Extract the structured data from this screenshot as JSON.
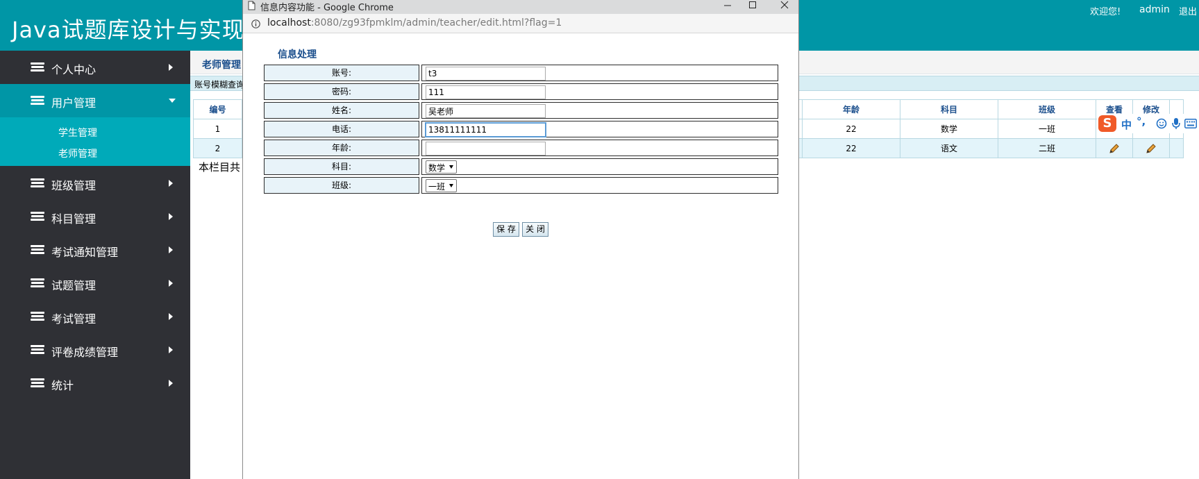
{
  "header": {
    "app_title": "Java试题库设计与实现",
    "welcome": "欢迎您!",
    "username": "admin",
    "logout": "退出"
  },
  "sidebar": {
    "items": [
      {
        "label": "个人中心"
      },
      {
        "label": "用户管理"
      },
      {
        "label": "班级管理"
      },
      {
        "label": "科目管理"
      },
      {
        "label": "考试通知管理"
      },
      {
        "label": "试题管理"
      },
      {
        "label": "考试管理"
      },
      {
        "label": "评卷成绩管理"
      },
      {
        "label": "统计"
      }
    ],
    "submenu": [
      "学生管理",
      "老师管理"
    ]
  },
  "main": {
    "title": "老师管理",
    "search_label": "账号模糊查询",
    "table": {
      "headers": [
        "编号",
        "年龄",
        "科目",
        "班级",
        "查看",
        "修改"
      ],
      "rows": [
        {
          "id": "1",
          "age": "22",
          "subject": "数学",
          "class": "一班"
        },
        {
          "id": "2",
          "age": "22",
          "subject": "语文",
          "class": "二班"
        }
      ]
    },
    "footer_note": "本栏目共"
  },
  "popup": {
    "window_title": "信息内容功能 - Google Chrome",
    "url_host": "localhost",
    "url_path": ":8080/zg93fpmklm/admin/teacher/edit.html?flag=1",
    "form_title": "信息处理",
    "fields": [
      {
        "label": "账号:",
        "value": "t3"
      },
      {
        "label": "密码:",
        "value": "111"
      },
      {
        "label": "姓名:",
        "value": "吴老师"
      },
      {
        "label": "电话:",
        "value": "13811111111"
      },
      {
        "label": "年龄:",
        "value": ""
      },
      {
        "label": "科目:",
        "value": "数学"
      },
      {
        "label": "班级:",
        "value": "一班"
      }
    ],
    "save_button": "保 存",
    "close_button": "关 闭"
  },
  "ime": {
    "logo": "S",
    "lang": "中",
    "punct": "°,"
  },
  "colors": {
    "header_bg": "#0096a6",
    "sidebar_bg": "#2f3035",
    "submenu_bg": "#00aab9",
    "title_blue": "#1a4e8c"
  }
}
